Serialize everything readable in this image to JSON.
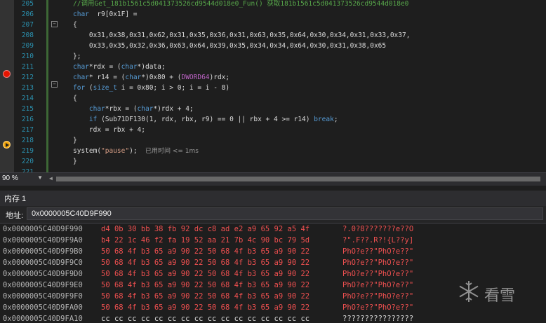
{
  "editor": {
    "lines": [
      {
        "n": "205",
        "segs": [
          [
            "cmt",
            "//调用Get_181b1561c5d041373526cd9544d018e0_Fun() 获取181b1561c5d041373526cd9544d018e0"
          ]
        ]
      },
      {
        "n": "206",
        "segs": [
          [
            "kw",
            "char"
          ],
          [
            "",
            "  r9[0x1F] ="
          ]
        ]
      },
      {
        "n": "207",
        "segs": [
          [
            "",
            "{"
          ]
        ]
      },
      {
        "n": "208",
        "segs": [
          [
            "",
            "    0x31,0x38,0x31,0x62,0x31,0x35,0x36,0x31,0x63,0x35,0x64,0x30,0x34,0x31,0x33,0x37,"
          ]
        ]
      },
      {
        "n": "209",
        "segs": [
          [
            "",
            "    0x33,0x35,0x32,0x36,0x63,0x64,0x39,0x35,0x34,0x34,0x64,0x30,0x31,0x38,0x65"
          ]
        ]
      },
      {
        "n": "210",
        "segs": [
          [
            "",
            "};"
          ]
        ]
      },
      {
        "n": "211",
        "segs": [
          [
            "kw",
            "char"
          ],
          [
            "",
            "*rdx = ("
          ],
          [
            "kw",
            "char"
          ],
          [
            "",
            "*)data;"
          ]
        ]
      },
      {
        "n": "212",
        "segs": [
          [
            "kw",
            "char"
          ],
          [
            "",
            "* r14 = ("
          ],
          [
            "kw",
            "char"
          ],
          [
            "",
            "*)0x80 + ("
          ],
          [
            "mac",
            "DWORD64"
          ],
          [
            "",
            ")rdx;"
          ]
        ]
      },
      {
        "n": "213",
        "segs": [
          [
            "kw",
            "for"
          ],
          [
            "",
            " ("
          ],
          [
            "kw",
            "size_t"
          ],
          [
            "",
            " i = 0x80; i > 0; i = i - 8)"
          ]
        ]
      },
      {
        "n": "214",
        "segs": [
          [
            "",
            "{"
          ]
        ]
      },
      {
        "n": "215",
        "segs": [
          [
            "",
            "    "
          ],
          [
            "kw",
            "char"
          ],
          [
            "",
            "*rbx = ("
          ],
          [
            "kw",
            "char"
          ],
          [
            "",
            "*)rdx + 4;"
          ]
        ]
      },
      {
        "n": "216",
        "segs": [
          [
            "",
            "    "
          ],
          [
            "kw",
            "if"
          ],
          [
            "",
            " (Sub71DF130(1, rdx, rbx, r9) == 0 || rbx + 4 >= r14) "
          ],
          [
            "kw",
            "break"
          ],
          [
            "",
            ";"
          ]
        ]
      },
      {
        "n": "217",
        "segs": [
          [
            "",
            "    rdx = rbx + 4;"
          ]
        ]
      },
      {
        "n": "218",
        "segs": [
          [
            "",
            "}"
          ]
        ]
      },
      {
        "n": "219",
        "segs": [
          [
            "",
            "system("
          ],
          [
            "str",
            "\"pause\""
          ],
          [
            "",
            ");  "
          ],
          [
            "perf",
            "已用时间 <= 1ms"
          ]
        ]
      },
      {
        "n": "220",
        "segs": [
          [
            "",
            "}"
          ]
        ]
      },
      {
        "n": "221",
        "segs": [
          [
            "",
            ""
          ]
        ]
      }
    ]
  },
  "status": {
    "zoom": "90 %"
  },
  "memory": {
    "title": "内存 1",
    "address_label": "地址:",
    "address_value": "0x0000005C40D9F990",
    "rows": [
      {
        "addr": "0x0000005C40D9F990",
        "hex": "d4 0b 30 bb 38 fb 92 dc c8 ad e2 a9 65 92 a5 4f",
        "ascii": "?.0?8???????e??O",
        "red": true
      },
      {
        "addr": "0x0000005C40D9F9A0",
        "hex": "b4 22 1c 46 f2 fa 19 52 aa 21 7b 4c 90 bc 79 5d",
        "ascii": "?\".F??.R?!{L??y]",
        "red": true
      },
      {
        "addr": "0x0000005C40D9F9B0",
        "hex": "50 68 4f b3 65 a9 90 22 50 68 4f b3 65 a9 90 22",
        "ascii": "PhO?e??\"PhO?e??\"",
        "red": true
      },
      {
        "addr": "0x0000005C40D9F9C0",
        "hex": "50 68 4f b3 65 a9 90 22 50 68 4f b3 65 a9 90 22",
        "ascii": "PhO?e??\"PhO?e??\"",
        "red": true
      },
      {
        "addr": "0x0000005C40D9F9D0",
        "hex": "50 68 4f b3 65 a9 90 22 50 68 4f b3 65 a9 90 22",
        "ascii": "PhO?e??\"PhO?e??\"",
        "red": true
      },
      {
        "addr": "0x0000005C40D9F9E0",
        "hex": "50 68 4f b3 65 a9 90 22 50 68 4f b3 65 a9 90 22",
        "ascii": "PhO?e??\"PhO?e??\"",
        "red": true
      },
      {
        "addr": "0x0000005C40D9F9F0",
        "hex": "50 68 4f b3 65 a9 90 22 50 68 4f b3 65 a9 90 22",
        "ascii": "PhO?e??\"PhO?e??\"",
        "red": true
      },
      {
        "addr": "0x0000005C40D9FA00",
        "hex": "50 68 4f b3 65 a9 90 22 50 68 4f b3 65 a9 90 22",
        "ascii": "PhO?e??\"PhO?e??\"",
        "red": true
      },
      {
        "addr": "0x0000005C40D9FA10",
        "hex": "cc cc cc cc cc cc cc cc cc cc cc cc cc cc cc cc",
        "ascii": "????????????????",
        "red": false
      }
    ]
  },
  "watermark": {
    "text": "看雪"
  },
  "icons": {
    "breakpoint": "breakpoint-icon",
    "current": "current-statement-icon",
    "collapse": "collapse-icon"
  },
  "colors": {
    "keyword": "#569cd6",
    "comment": "#57a64a",
    "string": "#d69d85",
    "changed": "#f05050",
    "breakpoint": "#e51400"
  }
}
